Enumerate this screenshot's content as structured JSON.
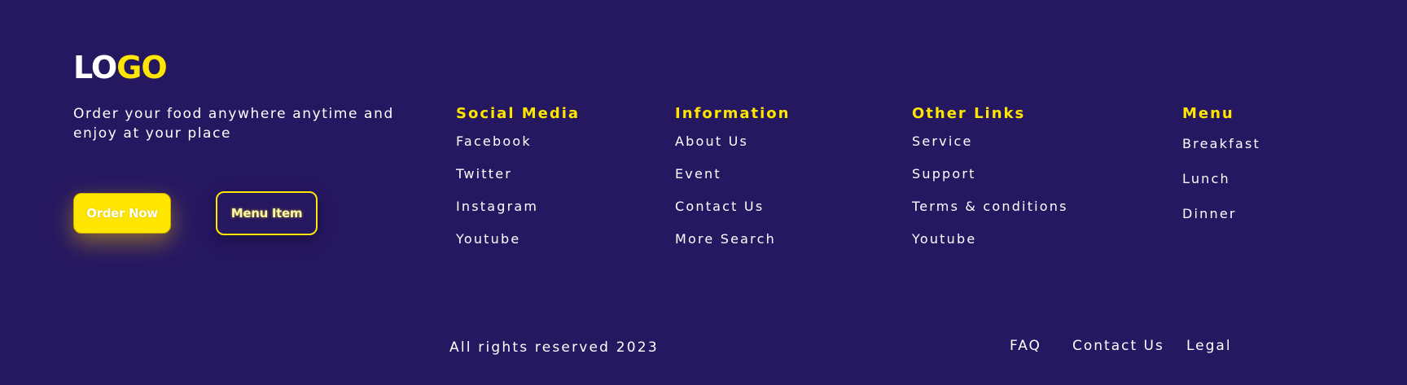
{
  "brand": {
    "logo_part1": "LO",
    "logo_part2": "GO",
    "tagline": "Order your food anywhere anytime and enjoy at your place"
  },
  "actions": {
    "order_now": "Order Now",
    "menu_item": "Menu Item"
  },
  "columns": [
    {
      "title": "Social Media",
      "links": [
        "Facebook",
        "Twitter",
        "Instagram",
        "Youtube"
      ]
    },
    {
      "title": "Information",
      "links": [
        "About Us",
        "Event",
        "Contact Us",
        "More Search"
      ]
    },
    {
      "title": "Other Links",
      "links": [
        "Service",
        "Support",
        "Terms & conditions",
        "Youtube"
      ]
    },
    {
      "title": "Menu",
      "links": [
        "Breakfast",
        "Lunch",
        "Dinner"
      ]
    }
  ],
  "bottom": {
    "copyright": "All rights reserved 2023",
    "links": [
      "FAQ",
      "Contact Us",
      "Legal"
    ]
  },
  "colors": {
    "background": "#261761",
    "accent": "#ffe600",
    "text": "#ffffff"
  }
}
